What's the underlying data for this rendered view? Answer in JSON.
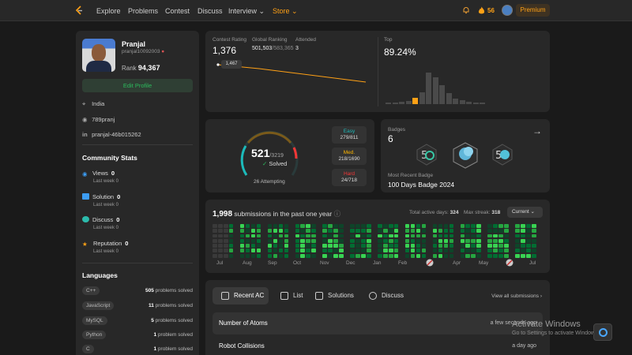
{
  "nav": {
    "items": [
      "Explore",
      "Problems",
      "Contest",
      "Discuss",
      "Interview",
      "Store"
    ],
    "streak": "56",
    "premium": "Premium"
  },
  "profile": {
    "name": "Pranjal",
    "handle": "pranjal10092003",
    "rank_label": "Rank",
    "rank_value": "94,367",
    "edit_label": "Edit Profile",
    "location": "India",
    "github": "789pranj",
    "linkedin": "pranjal-46b015262"
  },
  "community": {
    "title": "Community Stats",
    "items": [
      {
        "label": "Views",
        "value": "0",
        "sub": "Last week 0"
      },
      {
        "label": "Solution",
        "value": "0",
        "sub": "Last week 0"
      },
      {
        "label": "Discuss",
        "value": "0",
        "sub": "Last week 0"
      },
      {
        "label": "Reputation",
        "value": "0",
        "sub": "Last week 0"
      }
    ]
  },
  "languages": {
    "title": "Languages",
    "items": [
      {
        "name": "C++",
        "count": "505",
        "suffix": "problems solved"
      },
      {
        "name": "JavaScript",
        "count": "11",
        "suffix": "problems solved"
      },
      {
        "name": "MySQL",
        "count": "5",
        "suffix": "problems solved"
      },
      {
        "name": "Python",
        "count": "1",
        "suffix": "problem solved"
      },
      {
        "name": "C",
        "count": "1",
        "suffix": "problem solved"
      }
    ]
  },
  "contest": {
    "rating_label": "Contest Rating",
    "rating": "1,376",
    "global_label": "Global Ranking",
    "global": "501,503",
    "global_total": "/583,365",
    "attended_label": "Attended",
    "attended": "3",
    "tooltip": "1,467",
    "top_label": "Top",
    "top_value": "89.24%",
    "histogram": [
      0.05,
      0.05,
      0.08,
      0.1,
      0.2,
      0.38,
      1.0,
      0.85,
      0.6,
      0.35,
      0.18,
      0.12,
      0.08,
      0.05,
      0.04
    ],
    "highlight_index": 4
  },
  "solved": {
    "count": "521",
    "total": "/3219",
    "label": "Solved",
    "attempting": "26 Attempting",
    "easy": {
      "label": "Easy",
      "value": "279/811",
      "color": "#1cbaba"
    },
    "medium": {
      "label": "Med.",
      "value": "218/1690",
      "color": "#ffb700"
    },
    "hard": {
      "label": "Hard",
      "value": "24/718",
      "color": "#f63737"
    }
  },
  "badges": {
    "label": "Badges",
    "count": "6",
    "recent_label": "Most Recent Badge",
    "recent": "100 Days Badge 2024"
  },
  "submissions": {
    "count": "1,998",
    "text": "submissions in the past one year",
    "active_label": "Total active days:",
    "active": "324",
    "streak_label": "Max streak:",
    "streak": "318",
    "current": "Current",
    "months": [
      "Jul",
      "Aug",
      "Sep",
      "Oct",
      "Nov",
      "Dec",
      "Jan",
      "Feb",
      "",
      "Apr",
      "May",
      "",
      "Jul"
    ]
  },
  "recent": {
    "tabs": [
      "Recent AC",
      "List",
      "Solutions",
      "Discuss"
    ],
    "view_all": "View all submissions",
    "rows": [
      {
        "title": "Number of Atoms",
        "ago": "a few seconds ago"
      },
      {
        "title": "Robot Collisions",
        "ago": "a day ago"
      }
    ]
  },
  "watermark": {
    "title": "Activate Windows",
    "sub": "Go to Settings to activate Windows."
  }
}
